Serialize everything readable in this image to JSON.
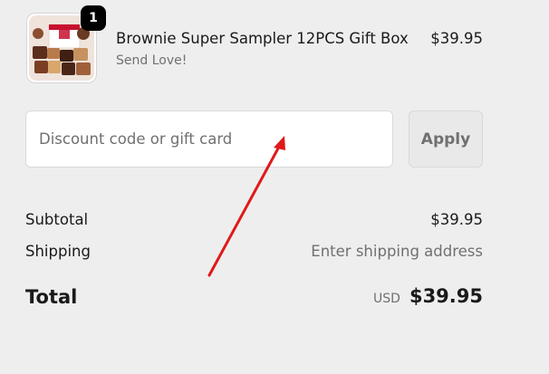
{
  "cart": {
    "items": [
      {
        "quantity": "1",
        "name": "Brownie Super Sampler 12PCS Gift Box",
        "variant": "Send Love!",
        "price": "$39.95",
        "thumbnail_label": "Send Love"
      }
    ]
  },
  "discount": {
    "placeholder": "Discount code or gift card",
    "value": "",
    "apply_label": "Apply"
  },
  "summary": {
    "subtotal_label": "Subtotal",
    "subtotal_value": "$39.95",
    "shipping_label": "Shipping",
    "shipping_value": "Enter shipping address",
    "total_label": "Total",
    "currency": "USD",
    "total_value": "$39.95"
  },
  "colors": {
    "background": "#eeeeee",
    "text_primary": "#1a1a1a",
    "text_secondary": "#707070",
    "badge": "#000000",
    "annotation_arrow": "#e0191a"
  },
  "annotation": {
    "icon": "red-arrow-icon"
  }
}
